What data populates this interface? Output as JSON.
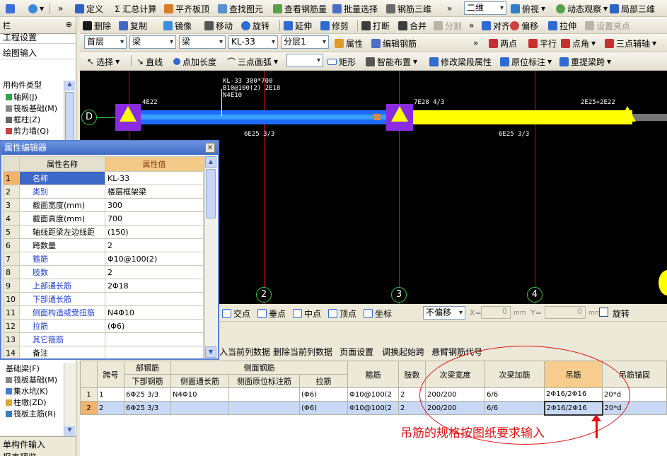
{
  "toolbar1": {
    "items": [
      "定义",
      "Σ 汇总计算",
      "平齐板顶",
      "查找图元",
      "查看钢筋量",
      "批量选择",
      "钢筋三维"
    ],
    "view": "二维",
    "items_right": [
      "俯视",
      "动态观察",
      "局部三维"
    ]
  },
  "toolbar2": {
    "items": [
      "删除",
      "复制",
      "镜像",
      "移动",
      "旋转",
      "延伸",
      "修剪",
      "打断",
      "合并",
      "分割"
    ],
    "items_right": [
      "对齐",
      "偏移",
      "拉伸",
      "设置夹点"
    ]
  },
  "toolbar3": {
    "floor": "首层",
    "type1": "梁",
    "type2": "梁",
    "element": "KL-33",
    "layer": "分层1",
    "attr": "属性",
    "edit": "编辑钢筋",
    "right": [
      "两点",
      "平行",
      "点角",
      "三点辅轴"
    ]
  },
  "toolbar4": {
    "items": [
      "选择",
      "直线",
      "点加长度",
      "三点画弧"
    ],
    "rect": "矩形",
    "smart": "智能布置",
    "modify": "修改梁段属性",
    "origin": "原位标注",
    "reid": "重提梁跨"
  },
  "leftpanel": {
    "tab1": "工程设置",
    "tab2": "绘图输入",
    "header": "用构件类型",
    "items": [
      "轴网(J)",
      "筏板基础(M)",
      "框柱(Z)",
      "剪力墙(Q)"
    ],
    "items_bottom": [
      "基础梁(F)",
      "筏板基础(M)",
      "集水坑(K)",
      "柱墩(ZD)",
      "筏板主筋(R)"
    ],
    "footer1": "单构件输入",
    "footer2": "报表预览",
    "top_mark": "栏",
    "pin": "⊕"
  },
  "canvas": {
    "texts": [
      "KL-33 300*700",
      "B10@100(2) 2E18",
      "N4E10",
      "4E22",
      "7E28 4/3",
      "2E25+2E22",
      "6E25 3/3",
      "6E25 3/3"
    ],
    "axis_d": "D",
    "axes": [
      "2",
      "3",
      "4"
    ]
  },
  "snapbar": {
    "items": [
      "交点",
      "垂点",
      "中点",
      "顶点",
      "坐标"
    ],
    "offset": "不偏移",
    "x_label": "X=",
    "y_label": "Y=",
    "x_val": "0",
    "y_val": "0",
    "mm1": "mm",
    "mm2": "mm",
    "rotate": "旋转"
  },
  "editbar": {
    "items": [
      "入当前列数据",
      "删除当前列数据",
      "页面设置",
      "调换起始跨",
      "悬臂钢筋代号"
    ]
  },
  "propwin": {
    "title": "属性编辑器",
    "col1": "属性名称",
    "col2": "属性值",
    "rows": [
      {
        "no": "1",
        "name": "名称",
        "value": "KL-33",
        "blue": false
      },
      {
        "no": "2",
        "name": "类别",
        "value": "楼层框架梁",
        "blue": true
      },
      {
        "no": "3",
        "name": "截面宽度(mm)",
        "value": "300",
        "blue": false
      },
      {
        "no": "4",
        "name": "截面高度(mm)",
        "value": "700",
        "blue": false
      },
      {
        "no": "5",
        "name": "轴线距梁左边线距",
        "value": "(150)",
        "blue": false
      },
      {
        "no": "6",
        "name": "跨数量",
        "value": "2",
        "blue": false
      },
      {
        "no": "7",
        "name": "箍筋",
        "value": "Φ10@100(2)",
        "blue": true
      },
      {
        "no": "8",
        "name": "肢数",
        "value": "2",
        "blue": true
      },
      {
        "no": "9",
        "name": "上部通长筋",
        "value": "2Φ18",
        "blue": true
      },
      {
        "no": "10",
        "name": "下部通长筋",
        "value": "",
        "blue": true
      },
      {
        "no": "11",
        "name": "侧面构造或受扭筋",
        "value": "N4Φ10",
        "blue": true
      },
      {
        "no": "12",
        "name": "拉筋",
        "value": "(Φ6)",
        "blue": true
      },
      {
        "no": "13",
        "name": "其它箍筋",
        "value": "",
        "blue": true
      },
      {
        "no": "14",
        "name": "备注",
        "value": "",
        "blue": false
      }
    ]
  },
  "grid": {
    "headers": {
      "span": "跨号",
      "bottom_group": "部钢筋",
      "bottom": "下部钢筋",
      "side_group": "侧面钢筋",
      "side_long": "侧面通长筋",
      "side_orig": "侧面原位标注筋",
      "tie": "拉筋",
      "stirrup": "箍筋",
      "legs": "肢数",
      "sub_width": "次梁宽度",
      "sub_add": "次梁加筋",
      "hanger": "吊筋",
      "anchor": "吊筋锚固"
    },
    "rows": [
      {
        "no": "1",
        "span": "1",
        "bottom": "6Φ25 3/3",
        "side_long": "N4Φ10",
        "side_orig": "",
        "tie": "(Φ6)",
        "stirrup": "Φ10@100(2",
        "legs": "2",
        "sub_width": "200/200",
        "sub_add": "6/6",
        "hanger": "2Φ16/2Φ16",
        "anchor": "20*d"
      },
      {
        "no": "2",
        "span": "2",
        "bottom": "6Φ25 3/3",
        "side_long": "",
        "side_orig": "",
        "tie": "(Φ6)",
        "stirrup": "Φ10@100(2",
        "legs": "2",
        "sub_width": "200/200",
        "sub_add": "6/6",
        "hanger": "2Φ16/2Φ16",
        "anchor": "20*d"
      }
    ]
  },
  "annotation": {
    "text": "吊筋的规格按图纸要求输入"
  },
  "colors": {
    "beam_blue": "#1e6bff",
    "beam_yellow": "#ffff00",
    "column": "#8a2be2",
    "axis_red": "#c8102e",
    "annotation": "#e01010"
  }
}
